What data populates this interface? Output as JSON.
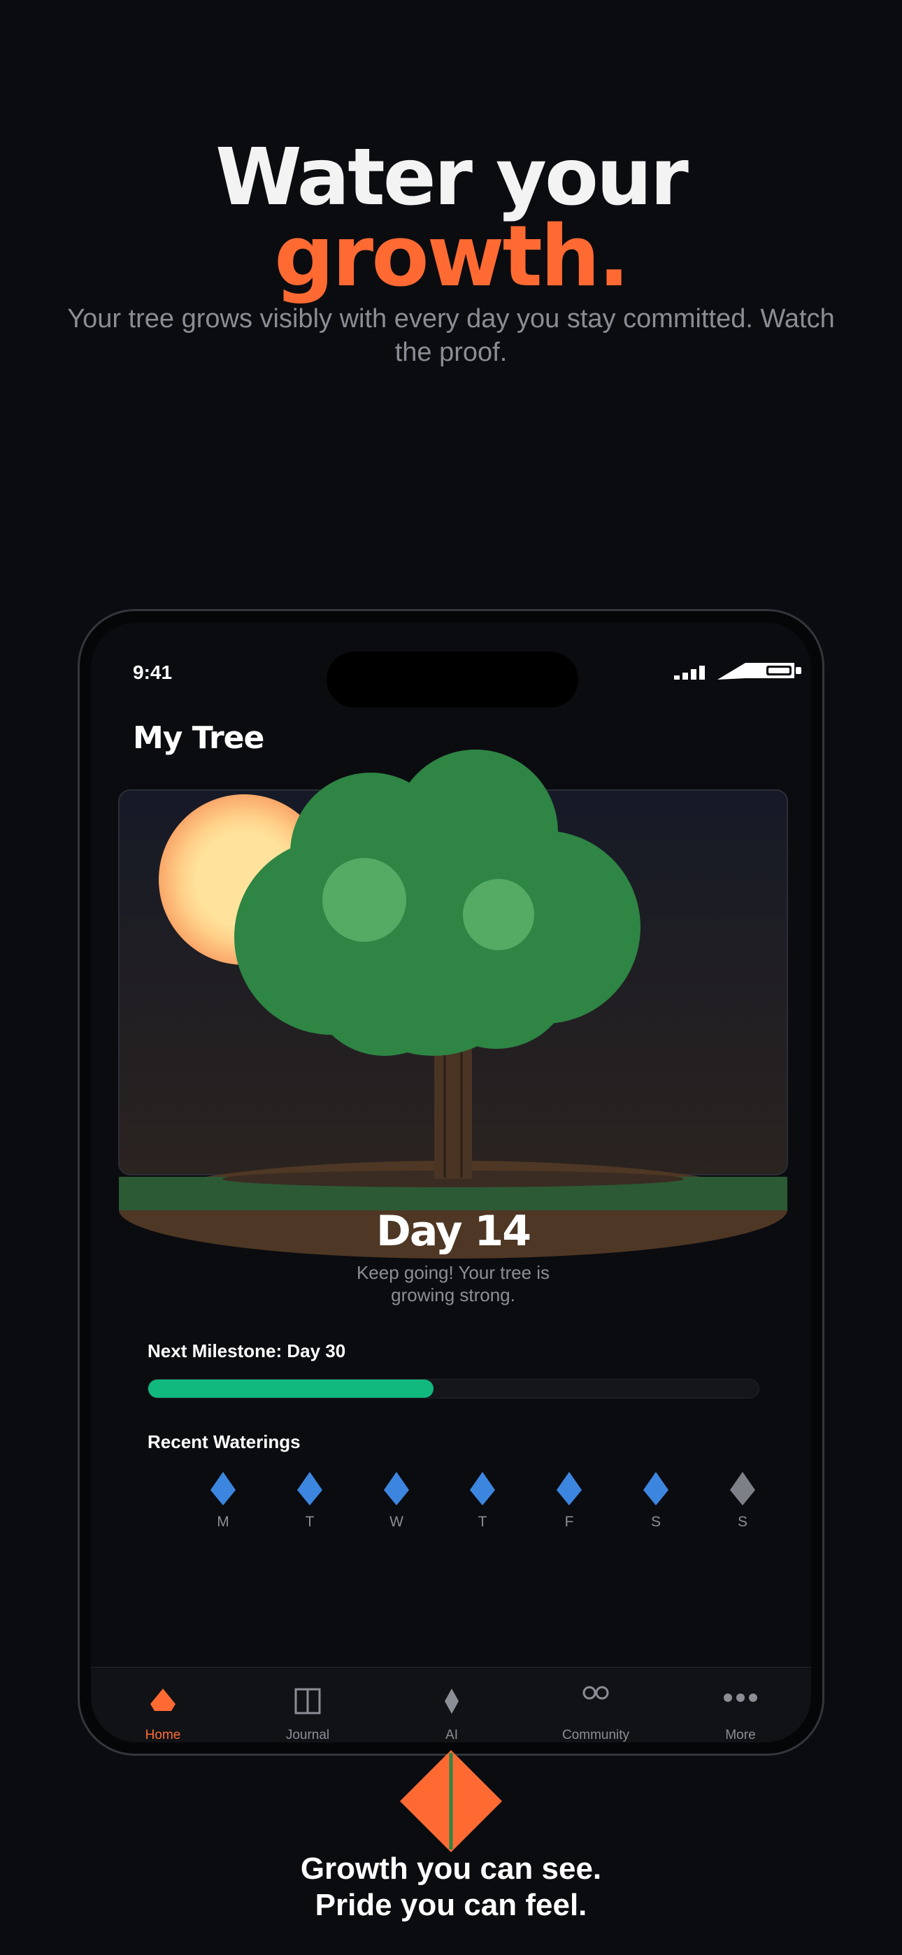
{
  "hero": {
    "line1": "Water your",
    "line2": "growth.",
    "subtitle": "Your tree grows visibly with every day you stay committed. Watch the proof."
  },
  "status_bar": {
    "time": "9:41"
  },
  "screen": {
    "title": "My Tree",
    "day_label": "Day 14",
    "encouragement": "Keep going! Your tree is growing strong."
  },
  "milestone": {
    "label": "Next Milestone: Day 30",
    "progress": 0.467
  },
  "waterings": {
    "label": "Recent Waterings",
    "days": [
      {
        "letter": "M",
        "watered": true
      },
      {
        "letter": "T",
        "watered": true
      },
      {
        "letter": "W",
        "watered": true
      },
      {
        "letter": "T",
        "watered": true
      },
      {
        "letter": "F",
        "watered": true
      },
      {
        "letter": "S",
        "watered": true
      },
      {
        "letter": "S",
        "watered": false
      }
    ]
  },
  "tabs": [
    {
      "label": "Home",
      "icon": "drop-icon",
      "active": true
    },
    {
      "label": "Journal",
      "icon": "book-icon",
      "active": false
    },
    {
      "label": "AI",
      "icon": "diamond-icon",
      "active": false
    },
    {
      "label": "Community",
      "icon": "infinity-icon",
      "active": false
    },
    {
      "label": "More",
      "icon": "more-dots-icon",
      "active": false
    }
  ],
  "tagline": {
    "line1": "Growth you can see.",
    "line2": "Pride you can feel."
  },
  "colors": {
    "accent": "#ff6a33",
    "progress": "#12b97e",
    "water": "#3d86e0",
    "tree": "#2e8544",
    "background": "#0b0c10"
  }
}
